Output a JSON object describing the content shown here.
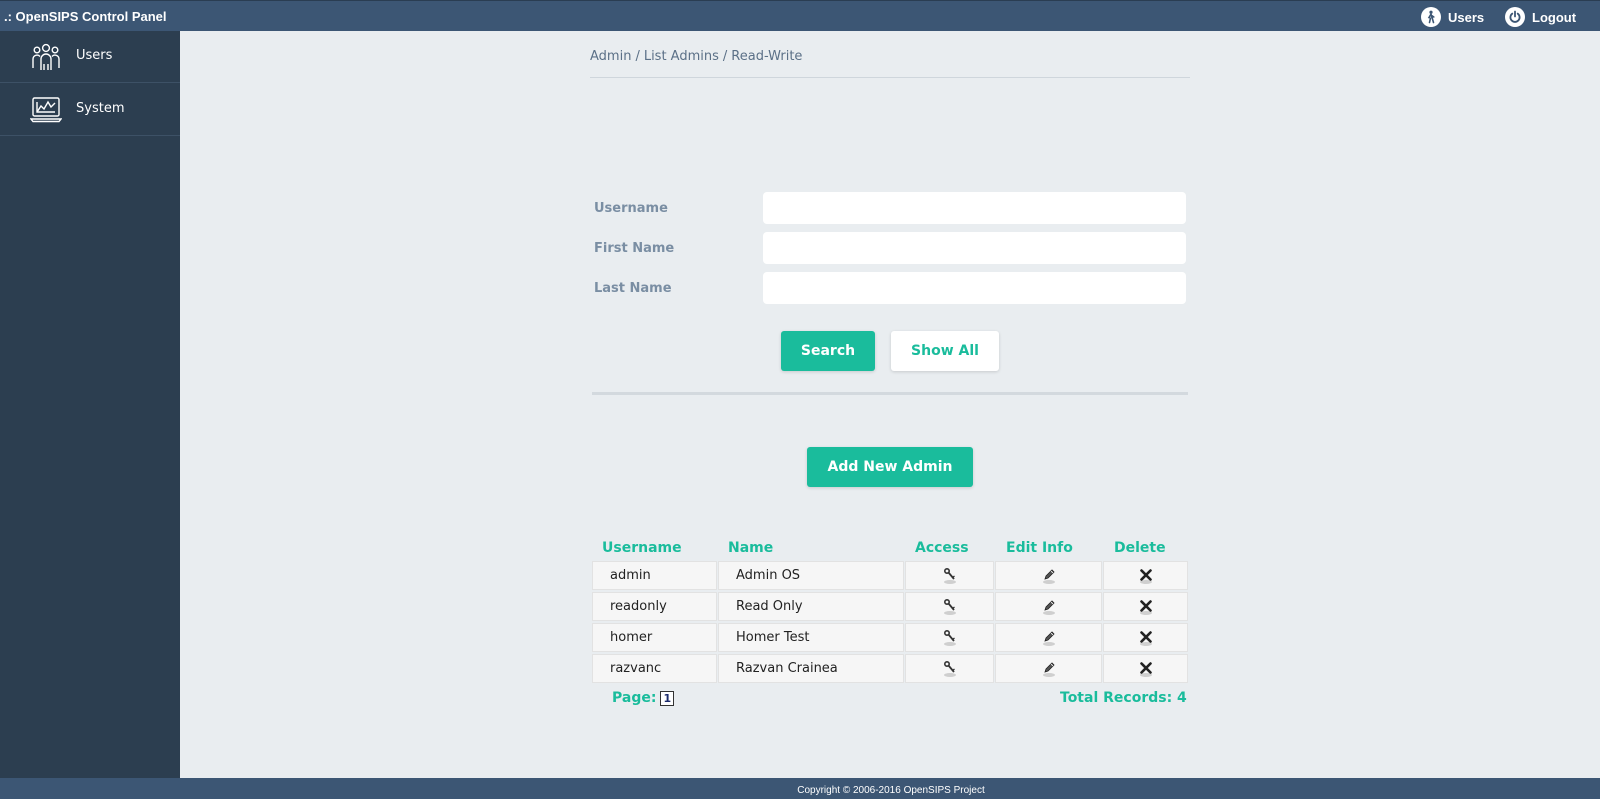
{
  "app": {
    "title": ".: OpenSIPS Control Panel"
  },
  "topbar": {
    "users_label": "Users",
    "users_icon": "user-walking-icon",
    "logout_label": "Logout",
    "logout_icon": "power-icon"
  },
  "sidebar": {
    "items": [
      {
        "label": "Users",
        "icon": "users-group-icon"
      },
      {
        "label": "System",
        "icon": "system-monitor-icon"
      }
    ]
  },
  "breadcrumb": [
    "Admin",
    "List Admins",
    "Read-Write"
  ],
  "search_form": {
    "fields": [
      {
        "label": "Username",
        "value": ""
      },
      {
        "label": "First Name",
        "value": ""
      },
      {
        "label": "Last Name",
        "value": ""
      }
    ],
    "search_label": "Search",
    "show_all_label": "Show All"
  },
  "add_button_label": "Add New Admin",
  "table": {
    "headers": [
      "Username",
      "Name",
      "Access",
      "Edit Info",
      "Delete"
    ],
    "rows": [
      {
        "username": "admin",
        "name": "Admin OS"
      },
      {
        "username": "readonly",
        "name": "Read Only"
      },
      {
        "username": "homer",
        "name": "Homer Test"
      },
      {
        "username": "razvanc",
        "name": "Razvan Crainea"
      }
    ]
  },
  "pager": {
    "page_label": "Page:",
    "current_page": "1",
    "total_label": "Total Records: 4"
  },
  "footer": {
    "copyright": "Copyright © 2006-2016 OpenSIPS Project"
  },
  "colors": {
    "accent": "#1abc9c",
    "topbar": "#3c5674",
    "sidebar": "#2c3e50",
    "background": "#e9edf0"
  }
}
